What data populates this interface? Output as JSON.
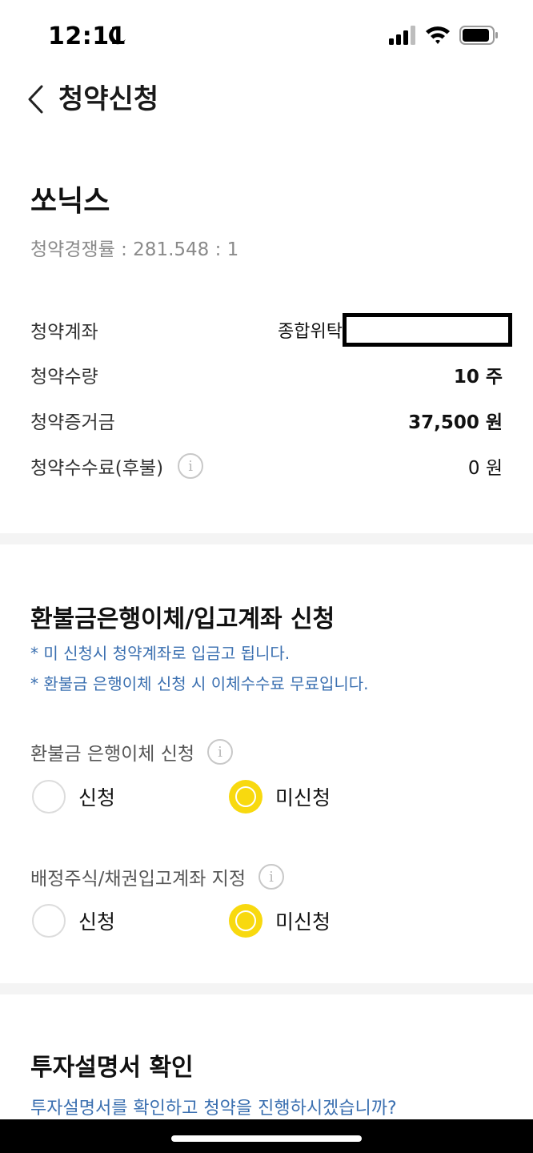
{
  "status_bar": {
    "time": "12:11",
    "icons": [
      "moon-icon",
      "signal-icon",
      "wifi-icon",
      "battery-icon"
    ]
  },
  "header": {
    "back_icon": "chevron-left-icon",
    "title": "청약신청"
  },
  "summary": {
    "stock_name": "쏘닉스",
    "competition": "청약경쟁률 : 281.548 : 1",
    "rows": {
      "account": {
        "label": "청약계좌",
        "value": "종합위탁"
      },
      "quantity": {
        "label": "청약수량",
        "value": "10 주"
      },
      "deposit": {
        "label": "청약증거금",
        "value": "37,500 원"
      },
      "fee": {
        "label": "청약수수료(후불)",
        "value": "0 원"
      }
    }
  },
  "refund_section": {
    "title": "환불금은행이체/입고계좌 신청",
    "notices": [
      "* 미 신청시 청약계좌로 입금고 됩니다.",
      "* 환불금 은행이체 신청 시 이체수수료 무료입니다."
    ],
    "options": [
      {
        "label": "환불금 은행이체 신청",
        "choices": [
          "신청",
          "미신청"
        ],
        "selected": "미신청"
      },
      {
        "label": "배정주식/채권입고계좌 지정",
        "choices": [
          "신청",
          "미신청"
        ],
        "selected": "미신청"
      }
    ]
  },
  "prospectus_section": {
    "title": "투자설명서 확인",
    "link": "투자설명서를 확인하고 청약을 진행하시겠습니까?"
  },
  "colors": {
    "accent_yellow": "#f8d90f",
    "notice_blue": "#3a6fb0",
    "divider_gray": "#f4f4f4"
  }
}
